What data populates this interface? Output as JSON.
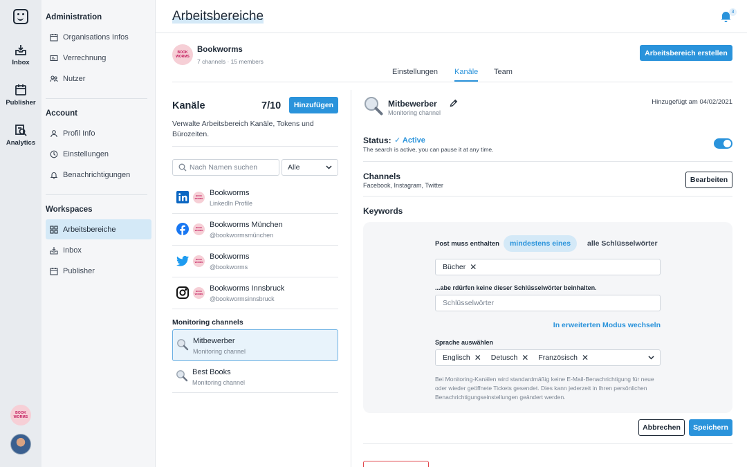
{
  "rail": {
    "items": [
      {
        "label": "Inbox",
        "icon": "inbox-icon"
      },
      {
        "label": "Publisher",
        "icon": "calendar-icon"
      },
      {
        "label": "Analytics",
        "icon": "analytics-icon"
      }
    ],
    "brand_avatar_text": "BOOK WORMS"
  },
  "sidebar": {
    "sections": [
      {
        "title": "Administration",
        "items": [
          {
            "label": "Organisations Infos",
            "icon": "calendar-icon"
          },
          {
            "label": "Verrechnung",
            "icon": "billing-icon"
          },
          {
            "label": "Nutzer",
            "icon": "users-icon"
          }
        ]
      },
      {
        "title": "Account",
        "items": [
          {
            "label": "Profil Info",
            "icon": "user-icon"
          },
          {
            "label": "Einstellungen",
            "icon": "clock-icon"
          },
          {
            "label": "Benachrichtigungen",
            "icon": "bell-icon"
          }
        ]
      },
      {
        "title": "Workspaces",
        "items": [
          {
            "label": "Arbeitsbereiche",
            "icon": "grid-icon",
            "active": true
          },
          {
            "label": "Inbox",
            "icon": "inbox-icon"
          },
          {
            "label": "Publisher",
            "icon": "calendar-icon"
          }
        ]
      }
    ]
  },
  "header": {
    "title": "Arbeitsbereiche",
    "notification_count": "3"
  },
  "workspace": {
    "name": "Bookworms",
    "meta": "7 channels · 15 members",
    "avatar_text": "BOOK WORMS",
    "create_button": "Arbeitsbereich erstellen",
    "tabs": [
      {
        "label": "Einstellungen",
        "active": false
      },
      {
        "label": "Kanäle",
        "active": true
      },
      {
        "label": "Team",
        "active": false
      }
    ]
  },
  "channels": {
    "title": "Kanäle",
    "count": "7/10",
    "add_button": "Hinzufügen",
    "description": "Verwalte Arbeitsbereich Kanäle, Tokens und Bürozeiten.",
    "search_placeholder": "Nach Namen suchen",
    "filter_value": "Alle",
    "list": [
      {
        "name": "Bookworms",
        "sub": "LinkedIn Profile",
        "network": "linkedin-icon"
      },
      {
        "name": "Bookworms München",
        "sub": "@bookwormsmünchen",
        "network": "facebook-icon"
      },
      {
        "name": "Bookworms",
        "sub": "@bookworms",
        "network": "twitter-icon"
      },
      {
        "name": "Bookworms Innsbruck",
        "sub": "@bookwormsinnsbruck",
        "network": "instagram-icon"
      }
    ],
    "monitoring_title": "Monitoring channels",
    "monitoring": [
      {
        "name": "Mitbewerber",
        "sub": "Monitoring channel",
        "selected": true
      },
      {
        "name": "Best Books",
        "sub": "Monitoring channel",
        "selected": false
      }
    ]
  },
  "detail": {
    "name": "Mitbewerber",
    "sub": "Monitoring channel",
    "added": "Hinzugefügt am 04/02/2021",
    "status_label": "Status:",
    "status_value": "Active",
    "status_desc": "The search is active, you can pause it at any time.",
    "toggle_on": true,
    "channels_title": "Channels",
    "channels_sub": "Facebook, Instagram, Twitter",
    "edit_button": "Bearbeiten",
    "keywords_title": "Keywords",
    "must_contain_label": "Post muss enthalten",
    "option_any": "mindestens eines",
    "option_all": "alle Schlüsselwörter",
    "include_keywords": [
      "Bücher"
    ],
    "exclude_label": "...abe rdürfen keine dieser Schlüsselwörter beinhalten.",
    "exclude_placeholder": "Schlüsselwörter",
    "advanced_link": "In erweiterten Modus wechseln",
    "language_label": "Sprache auswählen",
    "languages": [
      "Englisch",
      "Detusch",
      "Französisch"
    ],
    "note": "Bei Monitoring-Kanälen wird standardmäßig keine E-Mail-Benachrichtigung für neue oder wieder geöffnete Tickets gesendet. Dies kann jederzeit in Ihren persönlichen Benachrichtigungseinstellungen geändert werden.",
    "cancel_button": "Abbrechen",
    "save_button": "Speichern"
  },
  "colors": {
    "accent": "#2a93db",
    "active_bg": "#d4e9f7",
    "brand_pink": "#f6cfd6",
    "danger": "#e0474c"
  }
}
